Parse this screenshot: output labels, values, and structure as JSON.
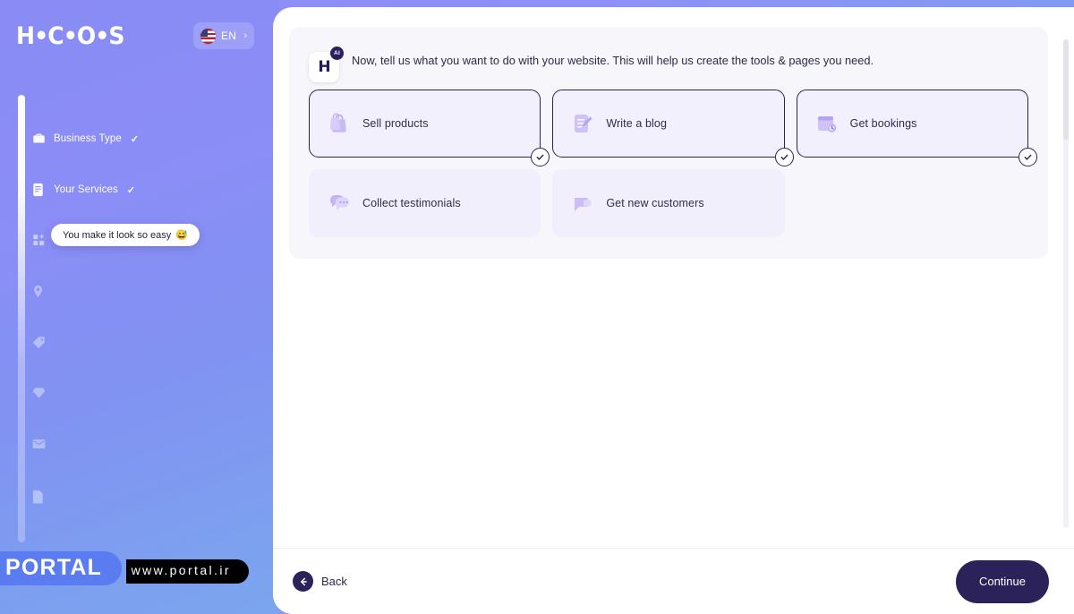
{
  "brand": {
    "logo_text": "H•C•O•S"
  },
  "language": {
    "code": "EN",
    "chevron": "›",
    "flag": "us-flag-icon"
  },
  "sidebar": {
    "steps": [
      {
        "label": "Business Type",
        "icon": "briefcase-icon",
        "check": "✓",
        "completed": true
      },
      {
        "label": "Your Services",
        "icon": "document-list-icon",
        "check": "✓",
        "completed": true
      },
      {
        "label": "",
        "icon": "apps-add-icon",
        "check": "",
        "completed": false
      },
      {
        "label": "",
        "icon": "location-pin-icon",
        "check": "",
        "completed": false
      },
      {
        "label": "",
        "icon": "tag-icon",
        "check": "",
        "completed": false
      },
      {
        "label": "",
        "icon": "gem-icon",
        "check": "",
        "completed": false
      },
      {
        "label": "",
        "icon": "envelope-icon",
        "check": "",
        "completed": false
      },
      {
        "label": "",
        "icon": "page-icon",
        "check": "",
        "completed": false
      }
    ],
    "tooltip": {
      "text": "You make it look so easy",
      "emoji": "😅"
    }
  },
  "main": {
    "assistant": {
      "mark": "H",
      "badge": "AI"
    },
    "question": "Now, tell us what you want to do with your website. This will help us create the tools & pages you need.",
    "options": [
      {
        "label": "Sell products",
        "icon": "shopping-bag-icon",
        "selected": true
      },
      {
        "label": "Write a blog",
        "icon": "note-pencil-icon",
        "selected": true
      },
      {
        "label": "Get bookings",
        "icon": "calendar-clock-icon",
        "selected": true
      },
      {
        "label": "Collect testimonials",
        "icon": "chat-quote-icon",
        "selected": false
      },
      {
        "label": "Get new customers",
        "icon": "megaphone-icon",
        "selected": false
      }
    ]
  },
  "footer": {
    "back_label": "Back",
    "continue_label": "Continue"
  },
  "watermark": {
    "title": "PORTAL",
    "url": "www.portal.ir"
  },
  "colors": {
    "brand_purple": "#8b8cf5",
    "accent_dark": "#2b2259",
    "card_bg": "#f2effd",
    "panel_bg": "#ffffff"
  }
}
